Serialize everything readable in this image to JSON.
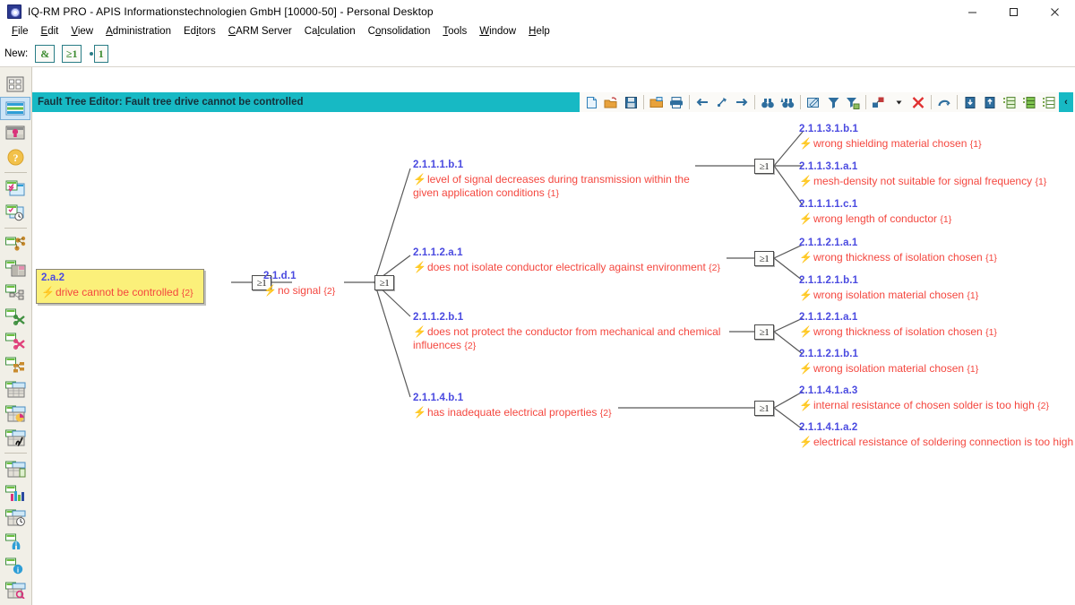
{
  "window": {
    "title": "IQ-RM PRO - APIS Informationstechnologien GmbH [10000-50] - Personal Desktop",
    "app_icon": "apis-logo-icon",
    "minimize": "minimize-icon",
    "maximize": "maximize-icon",
    "close": "close-icon"
  },
  "menubar": {
    "items": [
      {
        "label": "File",
        "accel": "F"
      },
      {
        "label": "Edit",
        "accel": "E"
      },
      {
        "label": "View",
        "accel": "V"
      },
      {
        "label": "Administration",
        "accel": "A"
      },
      {
        "label": "Editors",
        "accel": "i"
      },
      {
        "label": "CARM Server",
        "accel": "C"
      },
      {
        "label": "Calculation",
        "accel": "l"
      },
      {
        "label": "Consolidation",
        "accel": "o"
      },
      {
        "label": "Tools",
        "accel": "T"
      },
      {
        "label": "Window",
        "accel": "W"
      },
      {
        "label": "Help",
        "accel": "H"
      }
    ]
  },
  "newbar": {
    "label": "New:",
    "buttons": [
      {
        "name": "new-and-gate-button",
        "glyph": "&"
      },
      {
        "name": "new-or-gate-button",
        "glyph": "≥1"
      },
      {
        "name": "new-not-gate-button",
        "glyph": "1"
      }
    ]
  },
  "rail": {
    "items": [
      {
        "name": "structure-overview-icon",
        "selected": false
      },
      {
        "name": "form-sheet-icon",
        "selected": true
      },
      {
        "name": "table-insert-icon",
        "selected": false
      },
      {
        "name": "help-question-icon",
        "selected": false
      },
      {
        "name": "checklist-editor-icon",
        "selected": false
      },
      {
        "name": "action-history-icon",
        "selected": false
      },
      {
        "name": "structure-tree-icon",
        "selected": false
      },
      {
        "name": "split-view-icon",
        "selected": false
      },
      {
        "name": "flow-chart-icon",
        "selected": false
      },
      {
        "name": "scissors-green-icon",
        "selected": false
      },
      {
        "name": "scissors-pink-icon",
        "selected": false
      },
      {
        "name": "network-nodes-icon",
        "selected": false
      },
      {
        "name": "matrix-table-icon",
        "selected": false
      },
      {
        "name": "pie-chart-table-icon",
        "selected": false
      },
      {
        "name": "signature-table-icon",
        "selected": false
      },
      {
        "name": "document-table-icon",
        "selected": false
      },
      {
        "name": "bar-chart-icon",
        "selected": false
      },
      {
        "name": "clock-table-icon",
        "selected": false
      },
      {
        "name": "lungs-statistics-icon",
        "selected": false
      },
      {
        "name": "info-icon",
        "selected": false
      },
      {
        "name": "search-table-icon",
        "selected": false
      }
    ]
  },
  "editor": {
    "title": "Fault Tree Editor: Fault tree drive cannot be controlled",
    "header_color": "#17b9c4",
    "toolbar": [
      {
        "name": "new-document-icon"
      },
      {
        "name": "open-folder-icon"
      },
      {
        "name": "save-icon"
      },
      {
        "sep": true
      },
      {
        "name": "open-print-folder-icon"
      },
      {
        "name": "print-icon"
      },
      {
        "sep": true
      },
      {
        "name": "back-arrow-icon"
      },
      {
        "name": "bookmark-arrow-icon"
      },
      {
        "name": "forward-arrow-icon"
      },
      {
        "sep": true
      },
      {
        "name": "find-binoculars-icon"
      },
      {
        "name": "find-next-binoculars-icon"
      },
      {
        "sep": true
      },
      {
        "name": "edit-properties-icon"
      },
      {
        "name": "filter-icon"
      },
      {
        "name": "filter-save-icon"
      },
      {
        "sep": true
      },
      {
        "name": "layout-arrange-icon"
      },
      {
        "name": "dropdown-arrow-icon"
      },
      {
        "name": "delete-x-icon"
      },
      {
        "sep": true
      },
      {
        "name": "undo-arrow-icon"
      },
      {
        "sep": true
      },
      {
        "name": "export-down-icon"
      },
      {
        "name": "import-down-icon"
      },
      {
        "name": "list-add-icon"
      },
      {
        "name": "list-fill-icon"
      },
      {
        "name": "list-detail-icon"
      }
    ],
    "collapse_glyph": "‹"
  },
  "tree": {
    "root": {
      "code": "2.a.2",
      "desc": "drive cannot be controlled",
      "count": "{2}"
    },
    "level1": {
      "code": "2.1.d.1",
      "desc": "no signal",
      "count": "{2}"
    },
    "level2": [
      {
        "code": "2.1.1.1.b.1",
        "desc": "level of signal decreases during transmission within the given application conditions",
        "count": "{1}"
      },
      {
        "code": "2.1.1.2.a.1",
        "desc": "does not isolate conductor electrically against environment",
        "count": "{2}"
      },
      {
        "code": "2.1.1.2.b.1",
        "desc": "does not protect the conductor from mechanical and chemical influences",
        "count": "{2}"
      },
      {
        "code": "2.1.1.4.b.1",
        "desc": "has inadequate electrical properties",
        "count": "{2}"
      }
    ],
    "level3": [
      {
        "code": "2.1.1.3.1.b.1",
        "desc": "wrong shielding material chosen",
        "count": "{1}"
      },
      {
        "code": "2.1.1.3.1.a.1",
        "desc": "mesh-density not suitable for signal frequency",
        "count": "{1}"
      },
      {
        "code": "2.1.1.1.1.c.1",
        "desc": "wrong length of conductor",
        "count": "{1}"
      },
      {
        "code": "2.1.1.2.1.a.1",
        "desc": "wrong thickness of isolation chosen",
        "count": "{1}"
      },
      {
        "code": "2.1.1.2.1.b.1",
        "desc": "wrong isolation material chosen",
        "count": "{1}"
      },
      {
        "code": "2.1.1.2.1.a.1",
        "desc": "wrong thickness of isolation chosen",
        "count": "{1}"
      },
      {
        "code": "2.1.1.2.1.b.1",
        "desc": "wrong isolation material chosen",
        "count": "{1}"
      },
      {
        "code": "2.1.1.4.1.a.3",
        "desc": "internal resistance of chosen solder is too high",
        "count": "{2}"
      },
      {
        "code": "2.1.1.4.1.a.2",
        "desc": "electrical resistance of soldering connection is too high",
        "count": ""
      }
    ],
    "gates": {
      "or_label": "≥1"
    },
    "bolt_glyph": "⚡"
  },
  "colors": {
    "accent": "#17b9c4",
    "node_code": "#4a4ae0",
    "node_desc": "#f4473f",
    "root_fill": "#fbf07a",
    "rail_bg": "#f1efe7"
  }
}
